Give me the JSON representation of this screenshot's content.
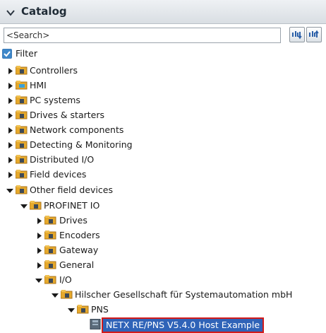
{
  "panel": {
    "title": "Catalog"
  },
  "search": {
    "value": "<Search>"
  },
  "filter": {
    "label": "Filter",
    "checked": true
  },
  "tree": {
    "controllers": "Controllers",
    "hmi": "HMI",
    "pc_systems": "PC systems",
    "drives_starters": "Drives & starters",
    "network_components": "Network components",
    "detecting_monitoring": "Detecting & Monitoring",
    "distributed_io": "Distributed I/O",
    "field_devices": "Field devices",
    "other_field_devices": "Other field devices",
    "profinet_io": "PROFINET IO",
    "drives": "Drives",
    "encoders": "Encoders",
    "gateway": "Gateway",
    "general": "General",
    "io": "I/O",
    "hilscher": "Hilscher Gesellschaft für Systemautomation mbH",
    "pns": "PNS",
    "netx_device": "NETX RE/PNS V5.4.0 Host Example"
  }
}
